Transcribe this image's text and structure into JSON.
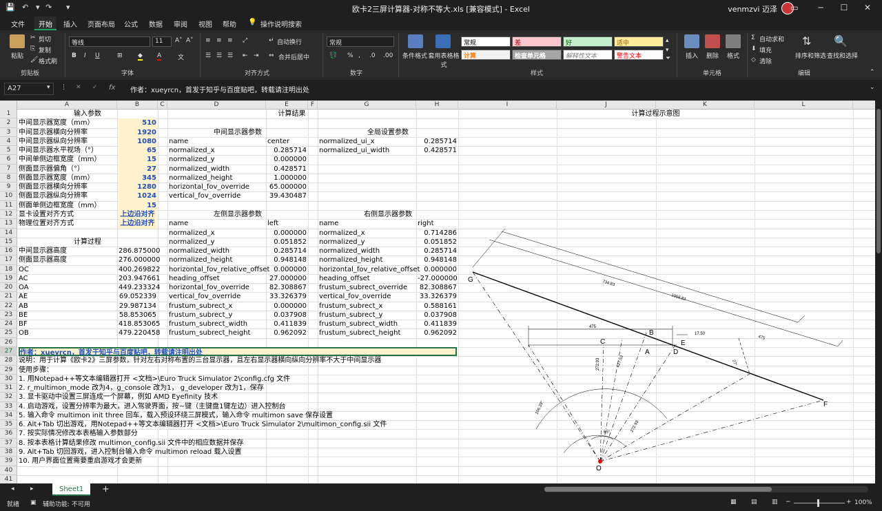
{
  "titlebar": {
    "title": "欧卡2三屏计算器-对称不等大.xls  [兼容模式]  -  Excel",
    "user": "venmzvi 迈泽",
    "minimize": "─",
    "restore": "☐",
    "close": "✕"
  },
  "menu": {
    "tabs": [
      "文件",
      "开始",
      "插入",
      "页面布局",
      "公式",
      "数据",
      "审阅",
      "视图",
      "帮助"
    ],
    "search": "操作说明搜索"
  },
  "ribbon": {
    "clipboard": {
      "paste": "粘贴",
      "cut": "剪切",
      "copy": "复制",
      "painter": "格式刷",
      "label": "剪贴板"
    },
    "font": {
      "name": "等线",
      "size": "11",
      "label": "字体"
    },
    "alignment": {
      "wrap": "自动换行",
      "merge": "合并后居中",
      "label": "对齐方式"
    },
    "number": {
      "format": "常规",
      "label": "数字"
    },
    "styles": {
      "cond": "条件格式",
      "table": "套用表格格式",
      "cells": [
        "常规",
        "差",
        "好",
        "适中",
        "计算",
        "检查单元格",
        "解释性文本",
        "警告文本"
      ],
      "label": "样式"
    },
    "cells_group": {
      "insert": "插入",
      "delete": "删除",
      "format": "格式",
      "label": "单元格"
    },
    "editing": {
      "autosum": "自动求和",
      "fill": "填充",
      "clear": "清除",
      "sort": "排序和筛选",
      "find": "查找和选择",
      "label": "编辑"
    }
  },
  "formula_bar": {
    "name_box": "A27",
    "fx": "fx",
    "content": "作者：xueyrcn，首发于知乎与百度贴吧，转载请注明出处"
  },
  "columns": [
    "A",
    "B",
    "C",
    "D",
    "E",
    "F",
    "G",
    "H",
    "I",
    "J",
    "K",
    "L"
  ],
  "rows": [
    "1",
    "2",
    "3",
    "4",
    "5",
    "6",
    "7",
    "8",
    "9",
    "10",
    "11",
    "12",
    "13",
    "14",
    "15",
    "16",
    "17",
    "18",
    "19",
    "20",
    "21",
    "22",
    "23",
    "24",
    "25",
    "26",
    "27",
    "28",
    "29",
    "30",
    "31",
    "32",
    "33",
    "34",
    "35",
    "36",
    "37",
    "38",
    "39",
    "40",
    "41"
  ],
  "headings": {
    "input": "输入参数",
    "results": "计算结果",
    "diagram": "计算过程示意图",
    "middle": "中间显示器参数",
    "global": "全局设置参数",
    "left": "左侧显示器参数",
    "right": "右侧显示器参数",
    "process": "计算过程"
  },
  "inputs": [
    {
      "label": "中间显示器宽度（mm）",
      "value": "510"
    },
    {
      "label": "中间显示器横向分辨率",
      "value": "1920"
    },
    {
      "label": "中间显示器纵向分辨率",
      "value": "1080"
    },
    {
      "label": "中间显示器水平视场（°）",
      "value": "65"
    },
    {
      "label": "中间单侧边框宽度（mm）",
      "value": "15"
    },
    {
      "label": "侧面显示器偏角（°）",
      "value": "27"
    },
    {
      "label": "侧面显示器宽度（mm）",
      "value": "345"
    },
    {
      "label": "侧面显示器横向分辨率",
      "value": "1280"
    },
    {
      "label": "侧面显示器纵向分辨率",
      "value": "1024"
    },
    {
      "label": "侧面单侧边框宽度（mm）",
      "value": "15"
    },
    {
      "label": "显卡设置对齐方式",
      "value": "上边沿对齐"
    },
    {
      "label": "物理位置对齐方式",
      "value": "上边沿对齐"
    }
  ],
  "middle_params": [
    [
      "name",
      "center"
    ],
    [
      "normalized_x",
      "0.285714"
    ],
    [
      "normalized_y",
      "0.000000"
    ],
    [
      "normalized_width",
      "0.428571"
    ],
    [
      "normalized_height",
      "1.000000"
    ],
    [
      "horizontal_fov_override",
      "65.000000"
    ],
    [
      "vertical_fov_override",
      "39.430487"
    ]
  ],
  "global_params": [
    [
      "normalized_ui_x",
      "0.285714"
    ],
    [
      "normalized_ui_width",
      "0.428571"
    ]
  ],
  "left_params": [
    [
      "name",
      "left"
    ],
    [
      "normalized_x",
      "0.000000"
    ],
    [
      "normalized_y",
      "0.051852"
    ],
    [
      "normalized_width",
      "0.285714"
    ],
    [
      "normalized_height",
      "0.948148"
    ],
    [
      "horizontal_fov_relative_offset",
      "0.000000"
    ],
    [
      "heading_offset",
      "27.000000"
    ],
    [
      "horizontal_fov_override",
      "82.308867"
    ],
    [
      "vertical_fov_override",
      "33.326379"
    ],
    [
      "frustum_subrect_x",
      "0.000000"
    ],
    [
      "frustum_subrect_y",
      "0.037908"
    ],
    [
      "frustum_subrect_width",
      "0.411839"
    ],
    [
      "frustum_subrect_height",
      "0.962092"
    ]
  ],
  "right_params": [
    [
      "name",
      "right"
    ],
    [
      "normalized_x",
      "0.714286"
    ],
    [
      "normalized_y",
      "0.051852"
    ],
    [
      "normalized_width",
      "0.285714"
    ],
    [
      "normalized_height",
      "0.948148"
    ],
    [
      "horizontal_fov_relative_offset",
      "0.000000"
    ],
    [
      "heading_offset",
      "-27.000000"
    ],
    [
      "frustum_subrect_override",
      "82.308867"
    ],
    [
      "vertical_fov_override",
      "33.326379"
    ],
    [
      "frustum_subrect_x",
      "0.588161"
    ],
    [
      "frustum_subrect_y",
      "0.037908"
    ],
    [
      "frustum_subrect_width",
      "0.411839"
    ],
    [
      "frustum_subrect_height",
      "0.962092"
    ]
  ],
  "process": [
    [
      "中间显示器高度",
      "286.875000"
    ],
    [
      "侧面显示器高度",
      "276.000000"
    ],
    [
      "OC",
      "400.269822"
    ],
    [
      "AC",
      "203.947661"
    ],
    [
      "OA",
      "449.233324"
    ],
    [
      "AE",
      "69.052339"
    ],
    [
      "AB",
      "29.987134"
    ],
    [
      "BE",
      "58.853065"
    ],
    [
      "BF",
      "418.853065"
    ],
    [
      "OB",
      "479.220458"
    ]
  ],
  "author_line": "作者：xueyrcn，首发于知乎与百度贴吧，转载请注明出处",
  "notes": [
    "说明：用于计算《欧卡2》三屏参数，针对左右对称布置的三台显示器，且左右显示器横向纵向分辨率不大于中间显示器",
    "使用步骤：",
    "1. 用Notepad++等文本编辑器打开 <文档>\\Euro Truck Simulator 2\\config.cfg 文件",
    "2. r_multimon_mode 改为4，g_console 改为1，  g_developer 改为1，保存",
    "3. 显卡驱动中设置三屏连成一个屏幕，例如 AMD Eyefinity 技术",
    "4. 启动游戏，设置分辨率为最大，进入驾驶界面，按~键（主键盘1键左边）进入控制台",
    "5. 输入命令 multimon init three 回车，载入预设环绕三屏模式，输入命令 multimon save 保存设置",
    "6. Alt+Tab 切出游戏，用Notepad++等文本编辑器打开 <文档>\\Euro Truck Simulator 2\\multimon_config.sii 文件",
    "7. 按实际情况修改本表格输入参数部分",
    "8. 按本表格计算结果修改 multimon_config.sii 文件中的相应数据并保存",
    "9. Alt+Tab 切回游戏，进入控制台输入命令 multimon reload 载入设置",
    "10. 用户界面位置需要重启游戏才会更新"
  ],
  "diagram_labels": {
    "points": [
      "G",
      "C",
      "B",
      "A",
      "D",
      "E",
      "F",
      "O"
    ],
    "dims": [
      "734.83",
      "1008.83",
      "475",
      "17.50",
      "475",
      "27°",
      "272.93",
      "427.53",
      "65°",
      "106.39°",
      "272.93"
    ]
  },
  "sheet": {
    "name": "Sheet1",
    "add": "+"
  },
  "status": {
    "ready": "就绪",
    "accessibility": "辅助功能: 不可用",
    "zoom": "100%"
  }
}
